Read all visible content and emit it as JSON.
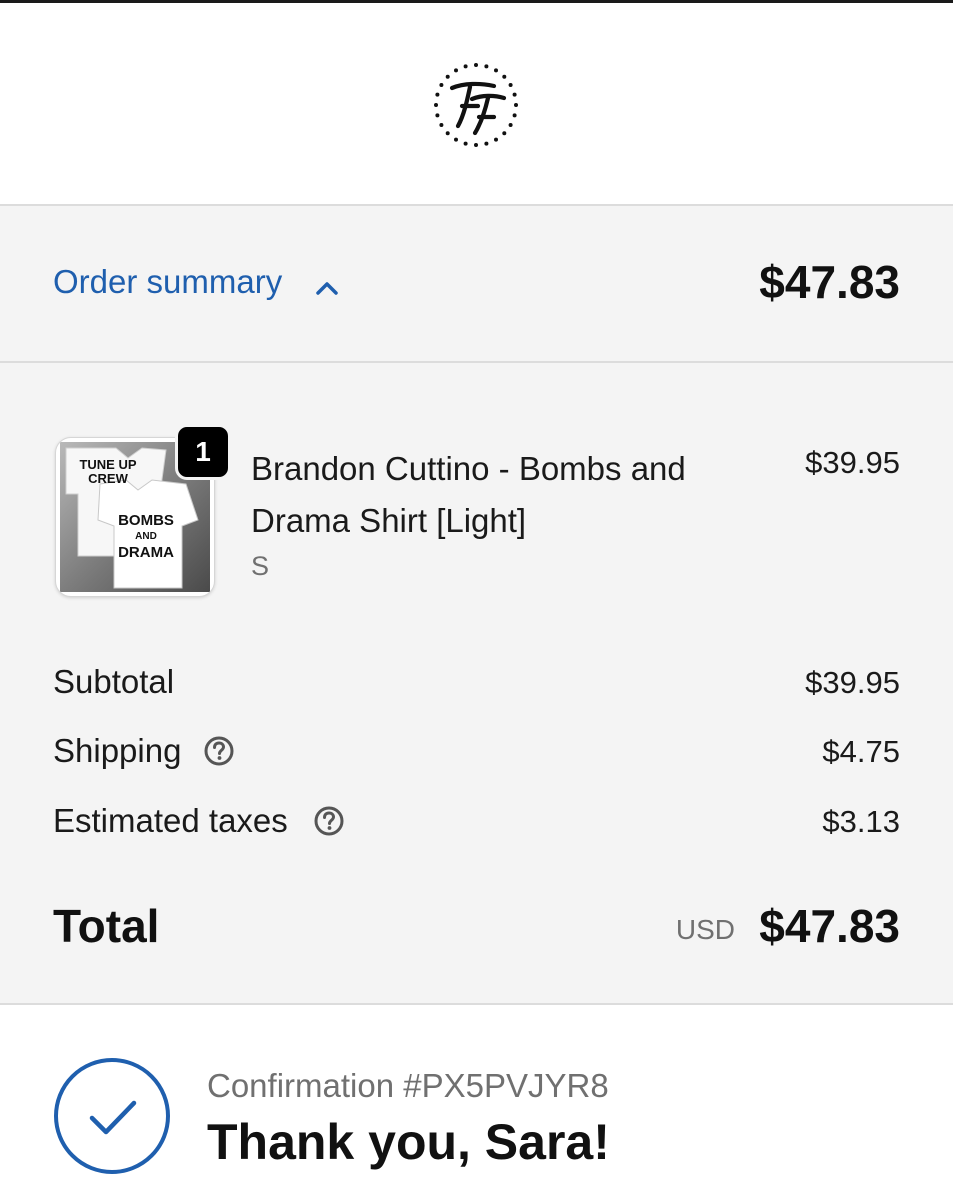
{
  "summary_toggle": {
    "label": "Order summary",
    "total": "$47.83"
  },
  "item": {
    "quantity": "1",
    "name": "Brandon Cuttino - Bombs and Drama Shirt [Light]",
    "variant": "S",
    "price": "$39.95",
    "thumbnail_text": [
      "TUNE UP",
      "CREW",
      "BOMBS",
      "AND",
      "DRAMA"
    ]
  },
  "lines": {
    "subtotal_label": "Subtotal",
    "subtotal_value": "$39.95",
    "shipping_label": "Shipping",
    "shipping_value": "$4.75",
    "taxes_label": "Estimated taxes",
    "taxes_value": "$3.13"
  },
  "total": {
    "label": "Total",
    "currency": "USD",
    "value": "$47.83"
  },
  "confirmation": {
    "number": "Confirmation #PX5PVJYR8",
    "thank_you": "Thank you, Sara!"
  },
  "colors": {
    "accent": "#1f5fae",
    "panel_bg": "#f4f4f4",
    "muted_text": "#707070"
  },
  "icons": [
    "store-logo",
    "chevron-up-icon",
    "help-icon",
    "check-circle-icon"
  ]
}
